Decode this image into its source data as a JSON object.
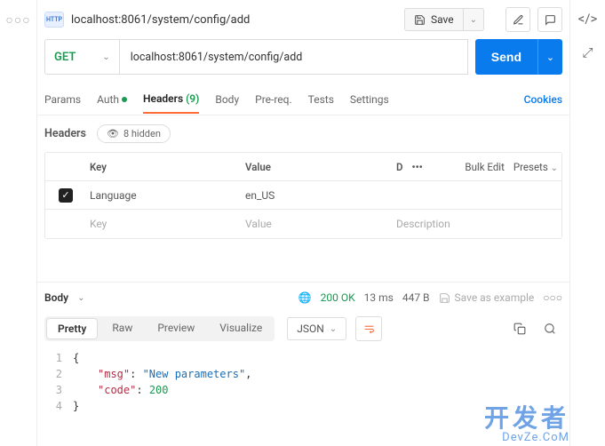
{
  "header": {
    "http_icon_label": "HTTP",
    "title": "localhost:8061/system/config/add",
    "save_label": "Save"
  },
  "request": {
    "method": "GET",
    "url": "localhost:8061/system/config/add",
    "send_label": "Send"
  },
  "tabs": {
    "params": "Params",
    "auth": "Auth",
    "headers": "Headers",
    "headers_count": "(9)",
    "body": "Body",
    "prereq": "Pre-req.",
    "tests": "Tests",
    "settings": "Settings",
    "cookies": "Cookies"
  },
  "headers_panel": {
    "title": "Headers",
    "hidden_label": "8 hidden",
    "col_key": "Key",
    "col_value": "Value",
    "col_desc_short": "D",
    "bulk_edit": "Bulk Edit",
    "presets": "Presets",
    "rows": [
      {
        "enabled": true,
        "key": "Language",
        "value": "en_US"
      }
    ],
    "placeholder_key": "Key",
    "placeholder_value": "Value",
    "placeholder_desc": "Description"
  },
  "response": {
    "body_tab": "Body",
    "status": "200 OK",
    "time": "13 ms",
    "size": "447 B",
    "save_example": "Save as example",
    "view_tabs": {
      "pretty": "Pretty",
      "raw": "Raw",
      "preview": "Preview",
      "visualize": "Visualize"
    },
    "format": "JSON",
    "code_lines": [
      {
        "n": "1",
        "indent": 0,
        "parts": [
          {
            "t": "brace",
            "v": "{"
          }
        ]
      },
      {
        "n": "2",
        "indent": 1,
        "parts": [
          {
            "t": "key",
            "v": "\"msg\""
          },
          {
            "t": "brace",
            "v": ": "
          },
          {
            "t": "str",
            "v": "\"New parameters\""
          },
          {
            "t": "brace",
            "v": ","
          }
        ]
      },
      {
        "n": "3",
        "indent": 1,
        "parts": [
          {
            "t": "key",
            "v": "\"code\""
          },
          {
            "t": "brace",
            "v": ": "
          },
          {
            "t": "num",
            "v": "200"
          }
        ]
      },
      {
        "n": "4",
        "indent": 0,
        "parts": [
          {
            "t": "brace",
            "v": "}"
          }
        ]
      }
    ]
  },
  "watermark": {
    "cn": "开发者",
    "en": "DevZe.CoM"
  }
}
